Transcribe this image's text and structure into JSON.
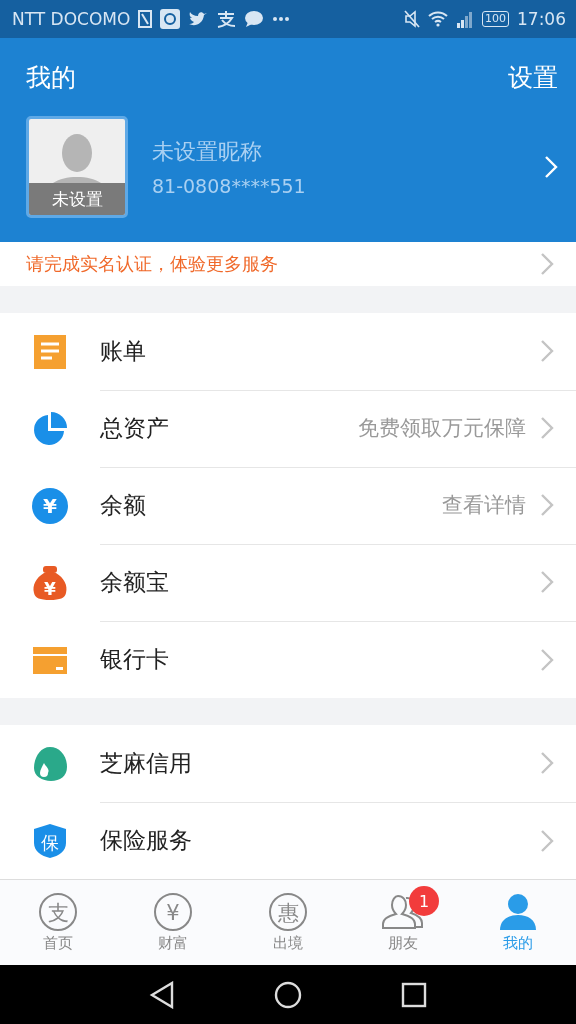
{
  "status_bar": {
    "carrier": "NTT DOCOMO",
    "battery": "100",
    "time": "17:06"
  },
  "header": {
    "title": "我的",
    "settings": "设置"
  },
  "profile": {
    "avatar_label": "未设置",
    "nickname": "未设置昵称",
    "phone": "81-0808****551"
  },
  "notice": {
    "text": "请完成实名认证，体验更多服务"
  },
  "sections": [
    {
      "items": [
        {
          "kind": "bill",
          "label": "账单"
        },
        {
          "kind": "assets",
          "label": "总资产",
          "hint": "免费领取万元保障"
        },
        {
          "kind": "balance",
          "label": "余额",
          "hint": "查看详情",
          "glyph": "¥"
        },
        {
          "kind": "fund",
          "label": "余额宝",
          "glyph": "¥"
        },
        {
          "kind": "card",
          "label": "银行卡"
        }
      ]
    },
    {
      "items": [
        {
          "kind": "credit",
          "label": "芝麻信用"
        },
        {
          "kind": "insurance",
          "label": "保险服务",
          "glyph": "保"
        }
      ]
    }
  ],
  "tabs": [
    {
      "kind": "home",
      "label": "首页",
      "glyph": "支",
      "selected": false
    },
    {
      "kind": "wealth",
      "label": "财富",
      "glyph": "¥",
      "selected": false
    },
    {
      "kind": "travel",
      "label": "出境",
      "glyph": "惠",
      "selected": false
    },
    {
      "kind": "friends",
      "label": "朋友",
      "badge": "1",
      "selected": false
    },
    {
      "kind": "me",
      "label": "我的",
      "selected": true
    }
  ]
}
